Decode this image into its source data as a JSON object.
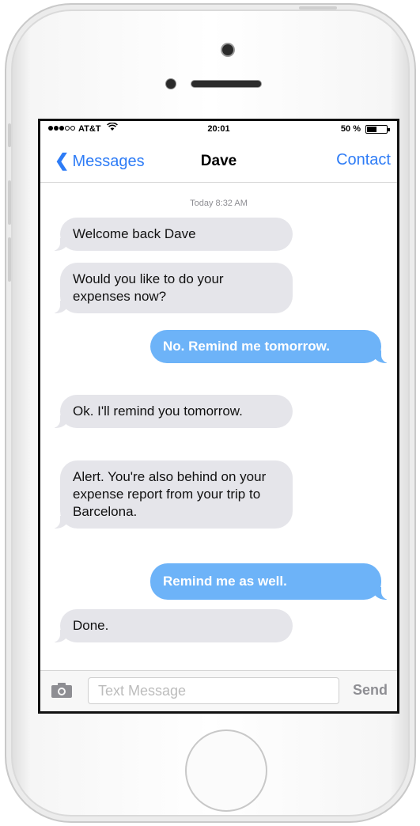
{
  "status_bar": {
    "carrier": "AT&T",
    "time": "20:01",
    "battery_percent": "50 %",
    "battery_level": 0.5,
    "signal_bars_filled": 3,
    "signal_bars_total": 5
  },
  "nav": {
    "back_label": "Messages",
    "title": "Dave",
    "contact_label": "Contact",
    "accent_color": "#2e7cf6"
  },
  "thread": {
    "timestamp": "Today 8:32 AM",
    "messages": [
      {
        "from": "them",
        "text": "Welcome back Dave"
      },
      {
        "from": "them",
        "text": "Would you like to do your expenses now?"
      },
      {
        "from": "me",
        "text": "No. Remind me tomorrow."
      },
      {
        "from": "them",
        "text": "Ok. I'll remind you tomorrow."
      },
      {
        "from": "them",
        "text": "Alert. You're also behind on your expense report from your trip to Barcelona."
      },
      {
        "from": "me",
        "text": "Remind me as well."
      },
      {
        "from": "them",
        "text": "Done."
      }
    ],
    "incoming_color": "#e5e5ea",
    "outgoing_color": "#6db3f8"
  },
  "compose": {
    "placeholder": "Text Message",
    "value": "",
    "send_label": "Send"
  }
}
